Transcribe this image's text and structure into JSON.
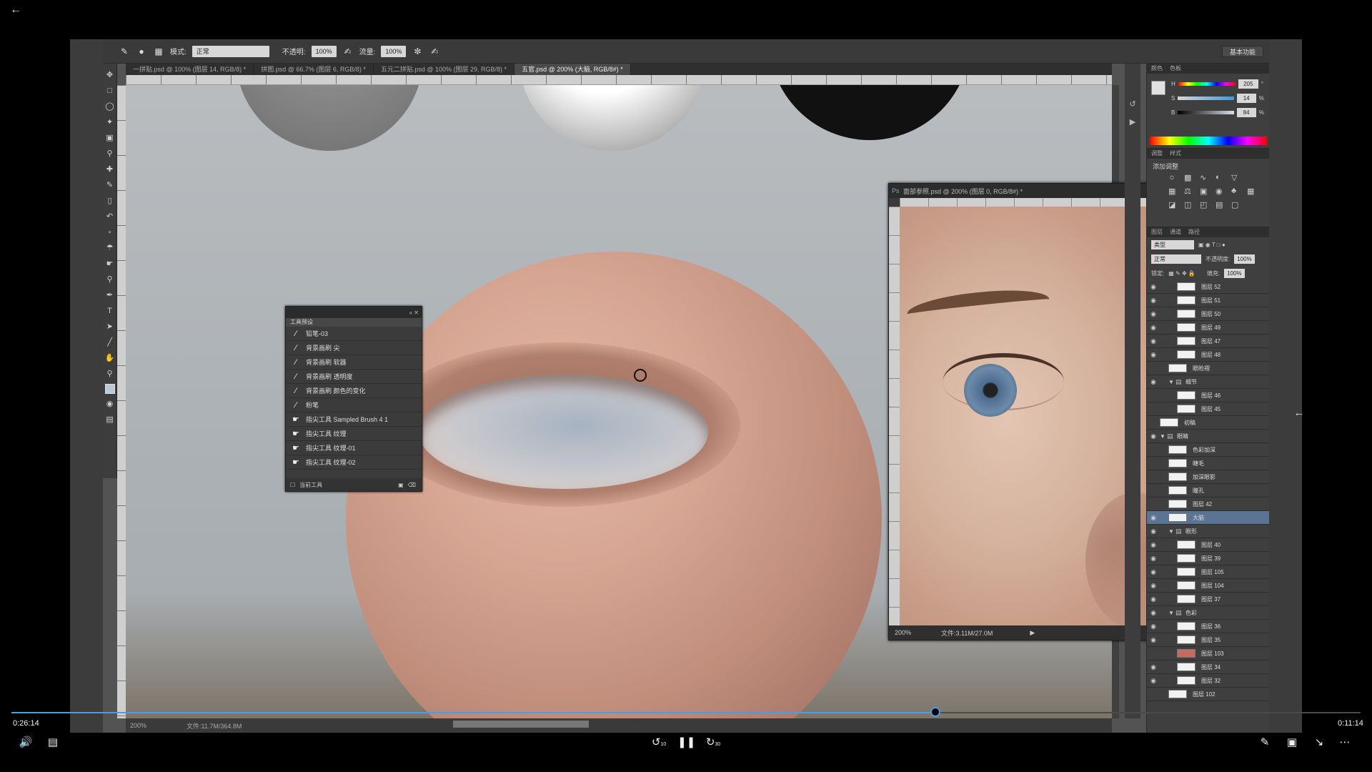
{
  "player": {
    "back_icon": "arrow-left-icon",
    "current_time": "0:26:14",
    "total_time": "0:11:14",
    "progress": 0.685,
    "accent": "#4d9be6",
    "controls": {
      "volume_icon": "volume-icon",
      "captions_icon": "captions-icon",
      "rewind_label": "10",
      "pause_icon": "pause-icon",
      "forward_label": "30",
      "pen_icon": "pen-icon",
      "miniplayer_icon": "miniplayer-icon",
      "exit_fullscreen_icon": "exit-fullscreen-icon",
      "more_icon": "more-icon"
    }
  },
  "photoshop": {
    "options": {
      "mode_label": "模式:",
      "mode_value": "正常",
      "opacity_label": "不透明:",
      "opacity_value": "100%",
      "flow_label": "流量:",
      "flow_value": "100%",
      "workspace": "基本功能"
    },
    "tabs": [
      {
        "label": "一拼贴.psd @ 100% (图层 14, RGB/8) *"
      },
      {
        "label": "拼图.psd @ 66.7% (图层 6, RGB/8) *"
      },
      {
        "label": "五元二拼贴.psd @ 100% (图层 29, RGB/8) *"
      },
      {
        "label": "五官.psd @ 200% (大脑, RGB/8#) *",
        "active": true
      }
    ],
    "canvas_status": {
      "zoom": "200%",
      "doc": "文件:11.7M/364.8M"
    },
    "presets": {
      "title": "工具预设",
      "items": [
        {
          "icon": "brush",
          "label": "铅笔-03"
        },
        {
          "icon": "brush",
          "label": "背景画刷 尖"
        },
        {
          "icon": "brush",
          "label": "背景画刷 软器"
        },
        {
          "icon": "brush",
          "label": "背景画刷 透明度"
        },
        {
          "icon": "brush",
          "label": "背景画刷 颜色的变化"
        },
        {
          "icon": "brush",
          "label": "粉笔"
        },
        {
          "icon": "smudge",
          "label": "指尖工具 Sampled Brush 4 1"
        },
        {
          "icon": "smudge",
          "label": "指尖工具 纹理"
        },
        {
          "icon": "smudge",
          "label": "指尖工具 纹理-01"
        },
        {
          "icon": "smudge",
          "label": "指尖工具 纹理-02"
        }
      ],
      "footer": "当前工具"
    },
    "ref_window": {
      "title": "面部参照.psd @ 200% (图层 0, RGB/8#) *",
      "zoom": "200%",
      "doc": "文件:3.11M/27.0M"
    },
    "color_panel": {
      "tabs": [
        "颜色",
        "色板"
      ],
      "h_label": "H",
      "s_label": "S",
      "b_label": "B",
      "h_value": "205",
      "s_value": "14",
      "b_value": "84",
      "unit_deg": "°",
      "unit_pct": "%"
    },
    "adjust_panel": {
      "tabs": [
        "调整",
        "样式"
      ],
      "title": "添加调整"
    },
    "layers_panel": {
      "tabs": [
        "图层",
        "通道",
        "路径"
      ],
      "filter": "类型",
      "blend": "正常",
      "opacity_label": "不透明度:",
      "opacity_value": "100%",
      "lock_label": "锁定:",
      "fill_label": "填充:",
      "fill_value": "100%",
      "layers": [
        {
          "name": "图层 52",
          "indent": 2,
          "visible": true
        },
        {
          "name": "图层 51",
          "indent": 2,
          "visible": true
        },
        {
          "name": "图层 50",
          "indent": 2,
          "visible": true
        },
        {
          "name": "图层 49",
          "indent": 2,
          "visible": true
        },
        {
          "name": "图层 47",
          "indent": 2,
          "visible": true
        },
        {
          "name": "图层 48",
          "indent": 2,
          "visible": true
        },
        {
          "name": "眼睑褶",
          "indent": 1,
          "visible": false
        },
        {
          "name": "细节",
          "indent": 1,
          "visible": true,
          "group": true
        },
        {
          "name": "图层 46",
          "indent": 2,
          "visible": false
        },
        {
          "name": "图层 45",
          "indent": 2,
          "visible": false
        },
        {
          "name": "初稿",
          "indent": 0,
          "visible": false
        },
        {
          "name": "眼睛",
          "indent": 0,
          "visible": true,
          "group": true
        },
        {
          "name": "色彩加深",
          "indent": 1,
          "visible": false
        },
        {
          "name": "睫毛",
          "indent": 1,
          "visible": false
        },
        {
          "name": "加深眼影",
          "indent": 1,
          "visible": false
        },
        {
          "name": "瞳孔",
          "indent": 1,
          "visible": false
        },
        {
          "name": "图层 42",
          "indent": 1,
          "visible": false
        },
        {
          "name": "大脑",
          "indent": 1,
          "visible": true,
          "selected": true
        },
        {
          "name": "眼形",
          "indent": 1,
          "visible": true,
          "group": true
        },
        {
          "name": "图层 40",
          "indent": 2,
          "visible": true
        },
        {
          "name": "图层 39",
          "indent": 2,
          "visible": true
        },
        {
          "name": "图层 105",
          "indent": 2,
          "visible": true
        },
        {
          "name": "图层 104",
          "indent": 2,
          "visible": true
        },
        {
          "name": "图层 37",
          "indent": 2,
          "visible": true
        },
        {
          "name": "色彩",
          "indent": 1,
          "visible": true,
          "group": true
        },
        {
          "name": "图层 36",
          "indent": 2,
          "visible": true
        },
        {
          "name": "图层 35",
          "indent": 2,
          "visible": true
        },
        {
          "name": "图层 103",
          "indent": 2,
          "visible": false,
          "red": true
        },
        {
          "name": "图层 34",
          "indent": 2,
          "visible": true
        },
        {
          "name": "图层 32",
          "indent": 2,
          "visible": true
        },
        {
          "name": "图层 102",
          "indent": 1,
          "visible": false
        }
      ]
    }
  }
}
